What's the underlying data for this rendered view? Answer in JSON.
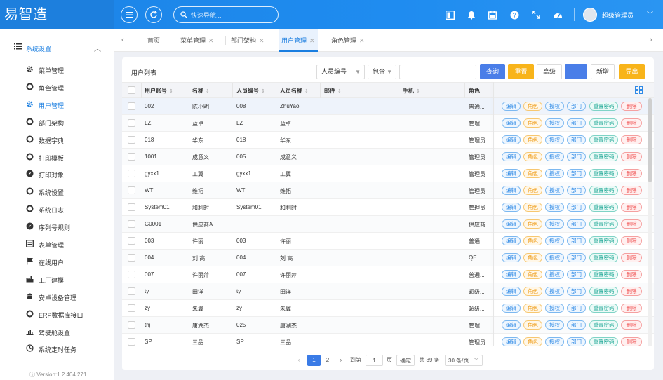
{
  "app": {
    "logo": "易智造"
  },
  "header": {
    "search_placeholder": "快速导航...",
    "user_name": "超级管理员"
  },
  "sidebar": {
    "group_label": "系统设置",
    "items": [
      {
        "label": "菜单管理",
        "icon": "gear-icon"
      },
      {
        "label": "角色管理",
        "icon": "circle-icon"
      },
      {
        "label": "用户管理",
        "icon": "gear-icon",
        "active": true
      },
      {
        "label": "部门架构",
        "icon": "circle-icon"
      },
      {
        "label": "数据字典",
        "icon": "circle-icon"
      },
      {
        "label": "打印模板",
        "icon": "circle-icon"
      },
      {
        "label": "打印对象",
        "icon": "compass-icon"
      },
      {
        "label": "系统设置",
        "icon": "circle-icon"
      },
      {
        "label": "系统日志",
        "icon": "circle-icon"
      },
      {
        "label": "序列号规则",
        "icon": "compass-icon"
      },
      {
        "label": "表单管理",
        "icon": "form-icon"
      },
      {
        "label": "在线用户",
        "icon": "flag-icon"
      },
      {
        "label": "工厂建模",
        "icon": "factory-icon"
      },
      {
        "label": "安卓设备管理",
        "icon": "android-icon"
      },
      {
        "label": "ERP数据库接口",
        "icon": "circle-icon"
      },
      {
        "label": "驾驶舱设置",
        "icon": "bar-chart-icon"
      },
      {
        "label": "系统定时任务",
        "icon": "clock-icon"
      }
    ],
    "version": "Version:1.2.404.271"
  },
  "tabs": [
    {
      "label": "首页",
      "closable": false
    },
    {
      "label": "菜单管理",
      "closable": true
    },
    {
      "label": "部门架构",
      "closable": true
    },
    {
      "label": "用户管理",
      "closable": true,
      "active": true
    },
    {
      "label": "角色管理",
      "closable": true
    }
  ],
  "panel": {
    "title": "用户列表",
    "filter_field": "人员编号",
    "filter_op": "包含",
    "filter_value": "",
    "buttons": {
      "query": "查询",
      "reset": "重置",
      "advanced": "高级",
      "more": "···",
      "add": "新增",
      "export": "导出"
    }
  },
  "table": {
    "columns": [
      "用户账号",
      "名称",
      "人员编号",
      "人员名称",
      "邮件",
      "手机",
      "角色"
    ],
    "action_labels": [
      "编辑",
      "角色",
      "授权",
      "部门",
      "重置密码",
      "删除"
    ],
    "rows": [
      {
        "account": "002",
        "name": "陈小明",
        "code": "008",
        "person": "ZhuYao",
        "email": "",
        "phone": "",
        "role": "普通..."
      },
      {
        "account": "LZ",
        "name": "蓝卓",
        "code": "LZ",
        "person": "蓝卓",
        "email": "",
        "phone": "",
        "role": "管理..."
      },
      {
        "account": "018",
        "name": "华东",
        "code": "018",
        "person": "华东",
        "email": "",
        "phone": "",
        "role": "管理员"
      },
      {
        "account": "1001",
        "name": "成意义",
        "code": "005",
        "person": "成意义",
        "email": "",
        "phone": "",
        "role": "管理员"
      },
      {
        "account": "gyxx1",
        "name": "工翼",
        "code": "gyxx1",
        "person": "工翼",
        "email": "",
        "phone": "",
        "role": "管理员"
      },
      {
        "account": "WT",
        "name": "维拓",
        "code": "WT",
        "person": "维拓",
        "email": "",
        "phone": "",
        "role": "管理员"
      },
      {
        "account": "System01",
        "name": "和利时",
        "code": "System01",
        "person": "和利时",
        "email": "",
        "phone": "",
        "role": "管理员"
      },
      {
        "account": "G0001",
        "name": "供应商A",
        "code": "",
        "person": "",
        "email": "",
        "phone": "",
        "role": "供应商"
      },
      {
        "account": "003",
        "name": "许丽",
        "code": "003",
        "person": "许丽",
        "email": "",
        "phone": "",
        "role": "普通..."
      },
      {
        "account": "004",
        "name": "刘 高",
        "code": "004",
        "person": "刘 高",
        "email": "",
        "phone": "",
        "role": "QE"
      },
      {
        "account": "007",
        "name": "许丽萍",
        "code": "007",
        "person": "许丽萍",
        "email": "",
        "phone": "",
        "role": "普通..."
      },
      {
        "account": "ty",
        "name": "田洋",
        "code": "ty",
        "person": "田洋",
        "email": "",
        "phone": "",
        "role": "超级..."
      },
      {
        "account": "zy",
        "name": "朱翼",
        "code": "zy",
        "person": "朱翼",
        "email": "",
        "phone": "",
        "role": "超级..."
      },
      {
        "account": "thj",
        "name": "唐湖杰",
        "code": "025",
        "person": "唐湖杰",
        "email": "",
        "phone": "",
        "role": "管理..."
      },
      {
        "account": "SP",
        "name": "三品",
        "code": "SP",
        "person": "三品",
        "email": "",
        "phone": "",
        "role": "管理员"
      }
    ]
  },
  "pagination": {
    "pages": [
      "1",
      "2"
    ],
    "current": "1",
    "goto_label": "到第",
    "goto_value": "1",
    "page_label": "页",
    "confirm": "确定",
    "total": "共 39 条",
    "page_size": "30 条/页"
  },
  "colors": {
    "header_bg": "#1f8cf0",
    "accent": "#1a7ee0",
    "query_btn": "#4a7ee8",
    "reset_btn": "#f8b41a"
  }
}
